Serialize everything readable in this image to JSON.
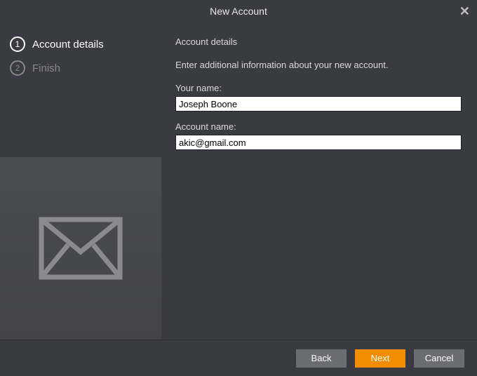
{
  "title": "New Account",
  "steps": [
    {
      "num": "1",
      "label": "Account details",
      "active": true
    },
    {
      "num": "2",
      "label": "Finish",
      "active": false
    }
  ],
  "main": {
    "heading": "Account details",
    "instruction": "Enter additional information about your new account.",
    "yourNameLabel": "Your name:",
    "yourNameValue": "Joseph Boone",
    "accountNameLabel": "Account name:",
    "accountNameValue": "akic@gmail.com"
  },
  "buttons": {
    "back": "Back",
    "next": "Next",
    "cancel": "Cancel"
  }
}
